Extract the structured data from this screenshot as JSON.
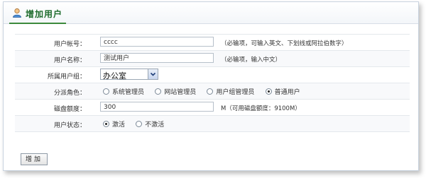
{
  "header": {
    "title": "增加用户",
    "icon": "user-icon"
  },
  "form": {
    "account": {
      "label": "用户帐号：",
      "value": "cccc",
      "hint": "（必输项，可输入英文、下划线或阿拉伯数字）"
    },
    "name": {
      "label": "用户名称：",
      "value": "测试用户",
      "hint": "（必输项，输入中文）"
    },
    "group": {
      "label": "所属用户组：",
      "selected": "办公室"
    },
    "role": {
      "label": "分派角色：",
      "options": [
        "系统管理员",
        "网站管理员",
        "用户组管理员",
        "普通用户"
      ],
      "selected": "普通用户"
    },
    "quota": {
      "label": "磁盘额度：",
      "value": "300",
      "hint": "M（可用磁盘额度：9100M）"
    },
    "status": {
      "label": "用户状态：",
      "options": [
        "激活",
        "不激活"
      ],
      "selected": "激活"
    }
  },
  "actions": {
    "submit_label": "增加"
  }
}
